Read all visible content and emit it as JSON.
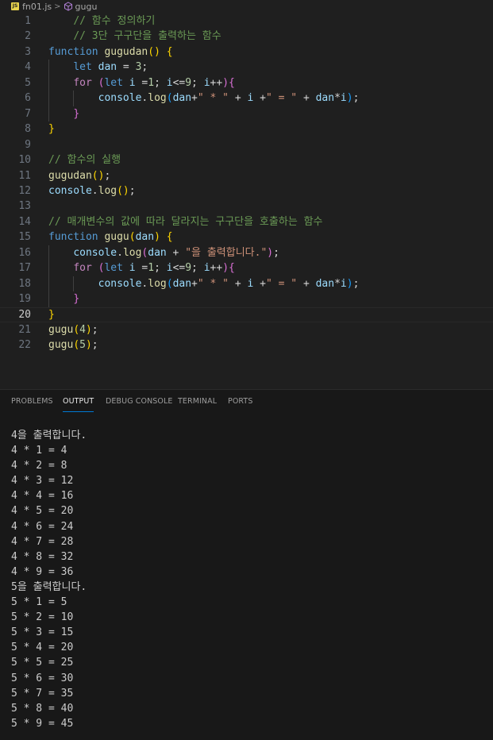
{
  "breadcrumb": {
    "file_icon_text": "JS",
    "file_name": "fn01.js",
    "separator": ">",
    "symbol_name": "gugu"
  },
  "editor": {
    "current_line": 20,
    "lines": [
      {
        "n": "1",
        "indent": 0,
        "tokens": [
          [
            "    ",
            ""
          ],
          [
            "// 함수 정의하기",
            "t-comment"
          ]
        ]
      },
      {
        "n": "2",
        "indent": 0,
        "tokens": [
          [
            "    ",
            ""
          ],
          [
            "// 3단 구구단을 출력하는 함수",
            "t-comment"
          ]
        ]
      },
      {
        "n": "3",
        "indent": 0,
        "tokens": [
          [
            "function",
            "t-kw"
          ],
          [
            " ",
            ""
          ],
          [
            "gugudan",
            "t-fn"
          ],
          [
            "()",
            "t-b1"
          ],
          [
            " ",
            ""
          ],
          [
            "{",
            "t-b1"
          ]
        ]
      },
      {
        "n": "4",
        "indent": 1,
        "tokens": [
          [
            "    ",
            ""
          ],
          [
            "let",
            "t-kw"
          ],
          [
            " ",
            ""
          ],
          [
            "dan",
            "t-var"
          ],
          [
            " = ",
            "t-op"
          ],
          [
            "3",
            "t-num"
          ],
          [
            ";",
            "t-op"
          ]
        ]
      },
      {
        "n": "5",
        "indent": 1,
        "tokens": [
          [
            "    ",
            ""
          ],
          [
            "for",
            "t-ctl"
          ],
          [
            " ",
            ""
          ],
          [
            "(",
            "t-b2"
          ],
          [
            "let",
            "t-kw"
          ],
          [
            " ",
            ""
          ],
          [
            "i",
            "t-var"
          ],
          [
            " =",
            "t-op"
          ],
          [
            "1",
            "t-num"
          ],
          [
            "; ",
            "t-op"
          ],
          [
            "i",
            "t-var"
          ],
          [
            "<=",
            "t-op"
          ],
          [
            "9",
            "t-num"
          ],
          [
            "; ",
            "t-op"
          ],
          [
            "i",
            "t-var"
          ],
          [
            "++",
            "t-op"
          ],
          [
            ")",
            "t-b2"
          ],
          [
            "{",
            "t-b2"
          ]
        ]
      },
      {
        "n": "6",
        "indent": 2,
        "tokens": [
          [
            "        ",
            ""
          ],
          [
            "console",
            "t-var"
          ],
          [
            ".",
            "t-op"
          ],
          [
            "log",
            "t-fn"
          ],
          [
            "(",
            "t-b3"
          ],
          [
            "dan",
            "t-var"
          ],
          [
            "+",
            "t-op"
          ],
          [
            "\" * \"",
            "t-str"
          ],
          [
            " + ",
            "t-op"
          ],
          [
            "i",
            "t-var"
          ],
          [
            " +",
            "t-op"
          ],
          [
            "\" = \"",
            "t-str"
          ],
          [
            " + ",
            "t-op"
          ],
          [
            "dan",
            "t-var"
          ],
          [
            "*",
            "t-op"
          ],
          [
            "i",
            "t-var"
          ],
          [
            ")",
            "t-b3"
          ],
          [
            ";",
            "t-op"
          ]
        ]
      },
      {
        "n": "7",
        "indent": 1,
        "tokens": [
          [
            "    ",
            ""
          ],
          [
            "}",
            "t-b2"
          ]
        ]
      },
      {
        "n": "8",
        "indent": 0,
        "tokens": [
          [
            "}",
            "t-b1"
          ]
        ]
      },
      {
        "n": "9",
        "indent": 0,
        "tokens": []
      },
      {
        "n": "10",
        "indent": 0,
        "tokens": [
          [
            "// 함수의 실행",
            "t-comment"
          ]
        ]
      },
      {
        "n": "11",
        "indent": 0,
        "tokens": [
          [
            "gugudan",
            "t-fn"
          ],
          [
            "()",
            "t-b1"
          ],
          [
            ";",
            "t-op"
          ]
        ]
      },
      {
        "n": "12",
        "indent": 0,
        "tokens": [
          [
            "console",
            "t-var"
          ],
          [
            ".",
            "t-op"
          ],
          [
            "log",
            "t-fn"
          ],
          [
            "()",
            "t-b1"
          ],
          [
            ";",
            "t-op"
          ]
        ]
      },
      {
        "n": "13",
        "indent": 0,
        "tokens": []
      },
      {
        "n": "14",
        "indent": 0,
        "tokens": [
          [
            "// 매개변수의 값에 따라 달라지는 구구단을 호출하는 함수",
            "t-comment"
          ]
        ]
      },
      {
        "n": "15",
        "indent": 0,
        "tokens": [
          [
            "function",
            "t-kw"
          ],
          [
            " ",
            ""
          ],
          [
            "gugu",
            "t-fn"
          ],
          [
            "(",
            "t-b1"
          ],
          [
            "dan",
            "t-var"
          ],
          [
            ")",
            "t-b1"
          ],
          [
            " ",
            ""
          ],
          [
            "{",
            "t-b1"
          ]
        ]
      },
      {
        "n": "16",
        "indent": 1,
        "tokens": [
          [
            "    ",
            ""
          ],
          [
            "console",
            "t-var"
          ],
          [
            ".",
            "t-op"
          ],
          [
            "log",
            "t-fn"
          ],
          [
            "(",
            "t-b2"
          ],
          [
            "dan",
            "t-var"
          ],
          [
            " + ",
            "t-op"
          ],
          [
            "\"을 출력합니다.\"",
            "t-str"
          ],
          [
            ")",
            "t-b2"
          ],
          [
            ";",
            "t-op"
          ]
        ]
      },
      {
        "n": "17",
        "indent": 1,
        "tokens": [
          [
            "    ",
            ""
          ],
          [
            "for",
            "t-ctl"
          ],
          [
            " ",
            ""
          ],
          [
            "(",
            "t-b2"
          ],
          [
            "let",
            "t-kw"
          ],
          [
            " ",
            ""
          ],
          [
            "i",
            "t-var"
          ],
          [
            " =",
            "t-op"
          ],
          [
            "1",
            "t-num"
          ],
          [
            "; ",
            "t-op"
          ],
          [
            "i",
            "t-var"
          ],
          [
            "<=",
            "t-op"
          ],
          [
            "9",
            "t-num"
          ],
          [
            "; ",
            "t-op"
          ],
          [
            "i",
            "t-var"
          ],
          [
            "++",
            "t-op"
          ],
          [
            ")",
            "t-b2"
          ],
          [
            "{",
            "t-b2"
          ]
        ]
      },
      {
        "n": "18",
        "indent": 2,
        "tokens": [
          [
            "        ",
            ""
          ],
          [
            "console",
            "t-var"
          ],
          [
            ".",
            "t-op"
          ],
          [
            "log",
            "t-fn"
          ],
          [
            "(",
            "t-b3"
          ],
          [
            "dan",
            "t-var"
          ],
          [
            "+",
            "t-op"
          ],
          [
            "\" * \"",
            "t-str"
          ],
          [
            " + ",
            "t-op"
          ],
          [
            "i",
            "t-var"
          ],
          [
            " +",
            "t-op"
          ],
          [
            "\" = \"",
            "t-str"
          ],
          [
            " + ",
            "t-op"
          ],
          [
            "dan",
            "t-var"
          ],
          [
            "*",
            "t-op"
          ],
          [
            "i",
            "t-var"
          ],
          [
            ")",
            "t-b3"
          ],
          [
            ";",
            "t-op"
          ]
        ]
      },
      {
        "n": "19",
        "indent": 1,
        "tokens": [
          [
            "    ",
            ""
          ],
          [
            "}",
            "t-b2"
          ]
        ]
      },
      {
        "n": "20",
        "indent": 0,
        "tokens": [
          [
            "}",
            "t-b1"
          ]
        ]
      },
      {
        "n": "21",
        "indent": 0,
        "tokens": [
          [
            "gugu",
            "t-fn"
          ],
          [
            "(",
            "t-b1"
          ],
          [
            "4",
            "t-num"
          ],
          [
            ")",
            "t-b1"
          ],
          [
            ";",
            "t-op"
          ]
        ]
      },
      {
        "n": "22",
        "indent": 0,
        "tokens": [
          [
            "gugu",
            "t-fn"
          ],
          [
            "(",
            "t-b1"
          ],
          [
            "5",
            "t-num"
          ],
          [
            ")",
            "t-b1"
          ],
          [
            ";",
            "t-op"
          ]
        ]
      }
    ]
  },
  "panel": {
    "active_tab": "OUTPUT",
    "tabs": [
      "PROBLEMS",
      "OUTPUT",
      "DEBUG CONSOLE",
      "TERMINAL",
      "PORTS"
    ],
    "output_lines": [
      "4을 출력합니다.",
      "4 * 1 = 4",
      "4 * 2 = 8",
      "4 * 3 = 12",
      "4 * 4 = 16",
      "4 * 5 = 20",
      "4 * 6 = 24",
      "4 * 7 = 28",
      "4 * 8 = 32",
      "4 * 9 = 36",
      "5을 출력합니다.",
      "5 * 1 = 5",
      "5 * 2 = 10",
      "5 * 3 = 15",
      "5 * 4 = 20",
      "5 * 5 = 25",
      "5 * 6 = 30",
      "5 * 7 = 35",
      "5 * 8 = 40",
      "5 * 9 = 45"
    ]
  }
}
